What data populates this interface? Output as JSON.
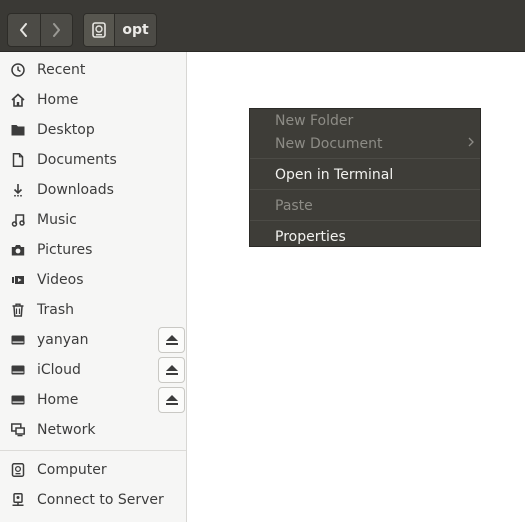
{
  "header": {
    "back_icon": "chevron-left-icon",
    "forward_icon": "chevron-right-icon",
    "path_root_icon": "drive-icon",
    "path_current": "opt"
  },
  "sidebar": {
    "items": [
      {
        "label": "Recent",
        "icon": "clock-icon"
      },
      {
        "label": "Home",
        "icon": "home-icon"
      },
      {
        "label": "Desktop",
        "icon": "folder-icon"
      },
      {
        "label": "Documents",
        "icon": "document-icon"
      },
      {
        "label": "Downloads",
        "icon": "download-icon"
      },
      {
        "label": "Music",
        "icon": "music-icon"
      },
      {
        "label": "Pictures",
        "icon": "camera-icon"
      },
      {
        "label": "Videos",
        "icon": "video-icon"
      },
      {
        "label": "Trash",
        "icon": "trash-icon"
      },
      {
        "label": "yanyan",
        "icon": "drive-icon",
        "eject": true
      },
      {
        "label": "iCloud",
        "icon": "drive-icon",
        "eject": true
      },
      {
        "label": "Home",
        "icon": "drive-icon",
        "eject": true
      },
      {
        "label": "Network",
        "icon": "network-icon"
      },
      {
        "label": "Computer",
        "icon": "computer-icon"
      },
      {
        "label": "Connect to Server",
        "icon": "server-icon"
      }
    ]
  },
  "context_menu": {
    "items": [
      {
        "label": "New Folder",
        "enabled": false
      },
      {
        "label": "New Document",
        "enabled": false,
        "submenu": true
      },
      {
        "label": "Open in Terminal",
        "enabled": true
      },
      {
        "label": "Paste",
        "enabled": false
      },
      {
        "label": "Properties",
        "enabled": true
      }
    ]
  },
  "colors": {
    "header_bg": "#3a3935",
    "sidebar_bg": "#f6f6f5",
    "menu_bg": "#3e3d38"
  }
}
